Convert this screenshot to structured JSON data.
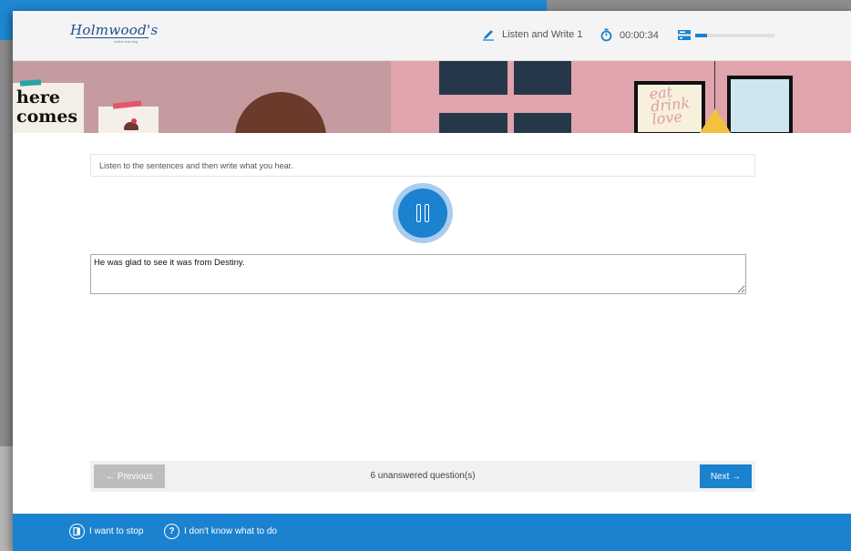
{
  "brand": {
    "logo_text": "Holmwood's",
    "logo_subtext": "online learning"
  },
  "header": {
    "task_label": "Listen and Write 1",
    "timer": "00:00:34",
    "progress_fraction": 0.15
  },
  "scene": {
    "poster_line1": "here",
    "poster_line2": "comes",
    "frame_text": "eat drink love"
  },
  "question": {
    "instruction": "Listen to the sentences and then write what you hear.",
    "answer_text": "He was glad to see it was from Destiny."
  },
  "navigation": {
    "previous_label": "← Previous",
    "status_text": "6 unanswered question(s)",
    "next_label": "Next →"
  },
  "footer": {
    "stop_label": "I want to stop",
    "help_label": "I don't know what to do",
    "help_icon_glyph": "?"
  },
  "colors": {
    "primary": "#1a82cf",
    "disabled": "#bdbdbd"
  },
  "icons": [
    "pencil-icon",
    "stopwatch-icon",
    "progress-icon",
    "pause-icon",
    "stop-icon",
    "help-icon"
  ]
}
